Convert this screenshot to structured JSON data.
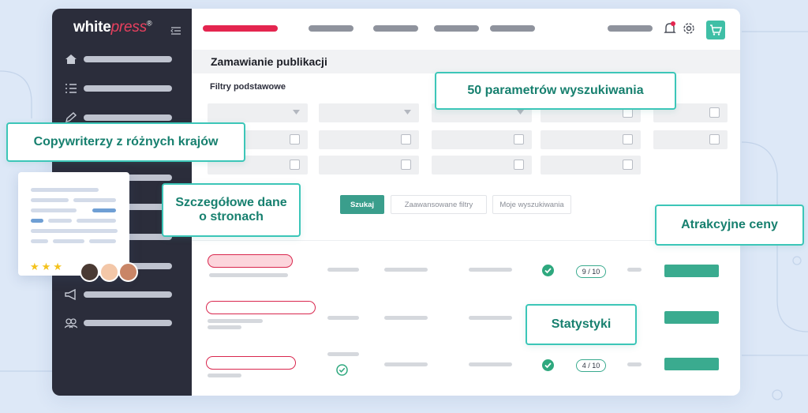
{
  "brand": {
    "name_white": "white",
    "name_press": "press",
    "mark": "®"
  },
  "header": {
    "page_title": "Zamawianie publikacji",
    "section_label": "Filtry podstawowe"
  },
  "actions": {
    "search_label": "Szukaj",
    "advanced_label": "Zaawansowane filtry",
    "saved_label": "Moje wyszukiwania"
  },
  "results": {
    "rows": [
      {
        "score": "9 / 10"
      },
      {
        "score": ""
      },
      {
        "score": "4 / 10"
      }
    ]
  },
  "callouts": {
    "copywriters": "Copywriterzy z różnych krajów",
    "parameters": "50 parametrów wyszukiwania",
    "site_data": "Szczegółowe dane o stronach",
    "prices": "Atrakcyjne ceny",
    "stats": "Statystyki"
  },
  "card": {
    "rating": "★★★"
  },
  "colors": {
    "accent": "#3cc6b8",
    "brand_red": "#e4254f",
    "sidebar": "#2b2d3b",
    "success": "#2ea87e"
  }
}
